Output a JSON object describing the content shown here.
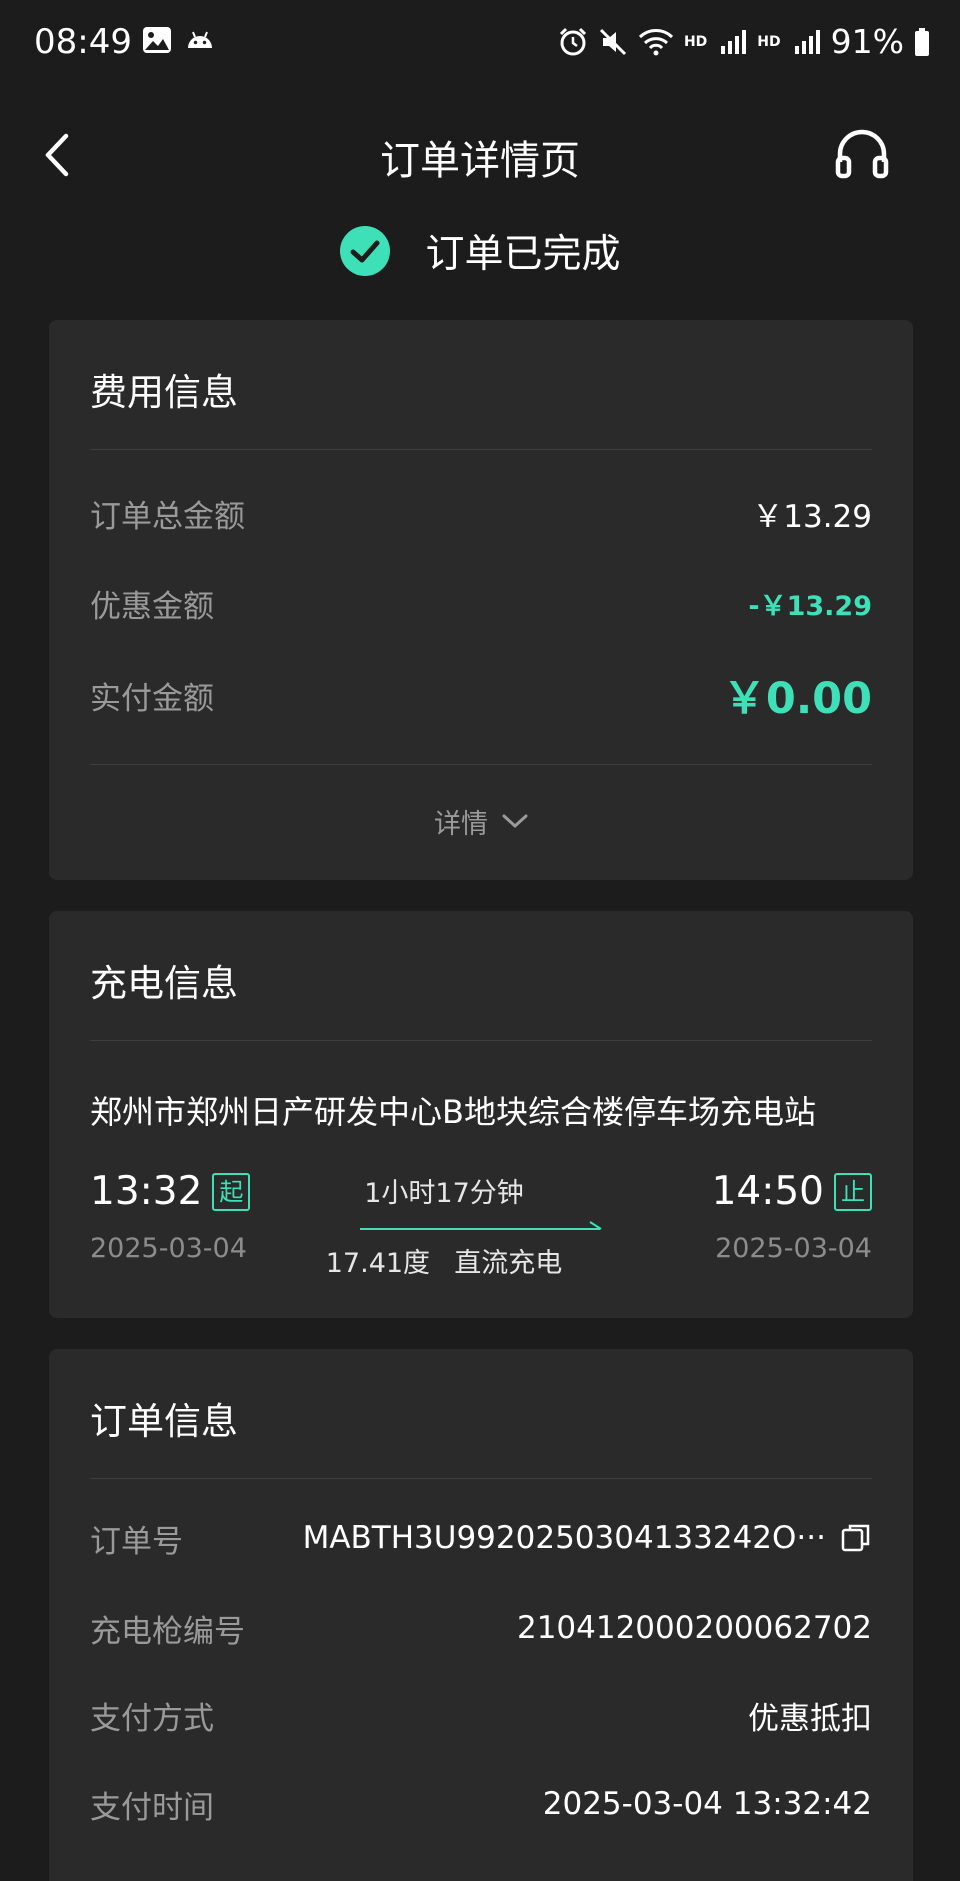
{
  "status_bar": {
    "time": "08:49",
    "battery": "91%",
    "hd1": "HD",
    "hd2": "HD",
    "icons": [
      "image-icon",
      "android-icon",
      "alarm-icon",
      "mute-icon",
      "wifi-icon",
      "signal-icon",
      "battery-icon"
    ]
  },
  "nav": {
    "title": "订单详情页",
    "back_icon": "chevron-left-icon",
    "support_icon": "headset-icon"
  },
  "order_status": {
    "text": "订单已完成",
    "icon": "check-circle-icon",
    "accent": "#3ee0b8"
  },
  "fee_info": {
    "title": "费用信息",
    "total_label": "订单总金额",
    "total_value": "￥13.29",
    "discount_label": "优惠金额",
    "discount_value": "-￥13.29",
    "paid_label": "实付金额",
    "paid_value": "￥0.00",
    "details_label": "详情"
  },
  "charge_info": {
    "title": "充电信息",
    "station": "郑州市郑州日产研发中心B地块综合楼停车场充电站",
    "start_time": "13:32",
    "start_tag": "起",
    "start_date": "2025-03-04",
    "duration": "1小时17分钟",
    "energy": "17.41度",
    "charge_type": "直流充电",
    "end_time": "14:50",
    "end_tag": "止",
    "end_date": "2025-03-04"
  },
  "order_info": {
    "title": "订单信息",
    "order_no_label": "订单号",
    "order_no_value": "MABTH3U9920250304133242O···",
    "gun_label": "充电枪编号",
    "gun_value": "210412000200062702",
    "pay_method_label": "支付方式",
    "pay_method_value": "优惠抵扣",
    "pay_time_label": "支付时间",
    "pay_time_value": "2025-03-04 13:32:42"
  }
}
